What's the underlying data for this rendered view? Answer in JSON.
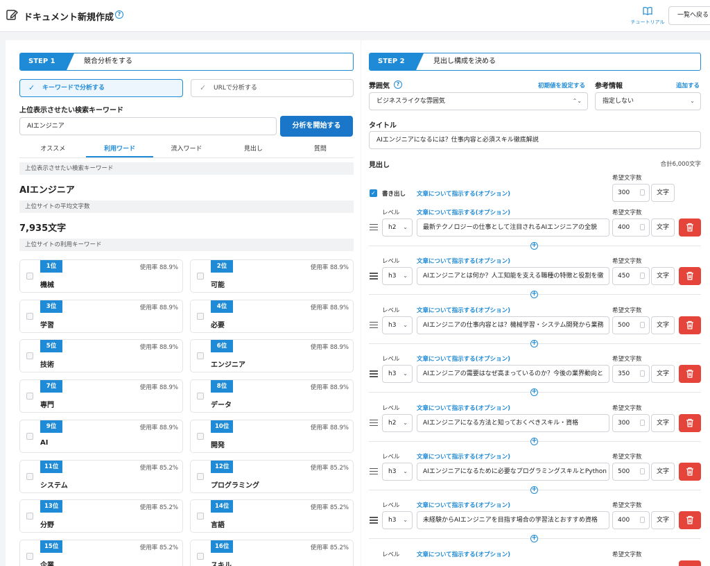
{
  "header": {
    "title": "ドキュメント新規作成",
    "tutorial_label": "チュートリアル",
    "back_label": "一覧へ戻る"
  },
  "left": {
    "step_badge": "STEP 1",
    "step_title": "競合分析をする",
    "mode_keyword": "キーワードで分析する",
    "mode_url": "URLで分析する",
    "keyword_label": "上位表示させたい検索キーワード",
    "keyword_value": "AIエンジニア",
    "start_button": "分析を開始する",
    "tabs": [
      "オススメ",
      "利用ワード",
      "流入ワード",
      "見出し",
      "質問"
    ],
    "active_tab": "利用ワード",
    "sec_keyword_band": "上位表示させたい検索キーワード",
    "keyword_display": "AIエンジニア",
    "sec_avg_band": "上位サイトの平均文字数",
    "avg_chars": "7,935文字",
    "sec_used_band": "上位サイトの利用キーワード",
    "keywords": [
      {
        "rank": "1位",
        "rate": "使用率 88.9%",
        "word": "機械"
      },
      {
        "rank": "2位",
        "rate": "使用率 88.9%",
        "word": "可能"
      },
      {
        "rank": "3位",
        "rate": "使用率 88.9%",
        "word": "学習"
      },
      {
        "rank": "4位",
        "rate": "使用率 88.9%",
        "word": "必要"
      },
      {
        "rank": "5位",
        "rate": "使用率 88.9%",
        "word": "技術"
      },
      {
        "rank": "6位",
        "rate": "使用率 88.9%",
        "word": "エンジニア"
      },
      {
        "rank": "7位",
        "rate": "使用率 88.9%",
        "word": "専門"
      },
      {
        "rank": "8位",
        "rate": "使用率 88.9%",
        "word": "データ"
      },
      {
        "rank": "9位",
        "rate": "使用率 88.9%",
        "word": "AI"
      },
      {
        "rank": "10位",
        "rate": "使用率 88.9%",
        "word": "開発"
      },
      {
        "rank": "11位",
        "rate": "使用率 85.2%",
        "word": "システム"
      },
      {
        "rank": "12位",
        "rate": "使用率 85.2%",
        "word": "プログラミング"
      },
      {
        "rank": "13位",
        "rate": "使用率 85.2%",
        "word": "分野"
      },
      {
        "rank": "14位",
        "rate": "使用率 85.2%",
        "word": "言語"
      },
      {
        "rank": "15位",
        "rate": "使用率 85.2%",
        "word": "企業"
      },
      {
        "rank": "16位",
        "rate": "使用率 85.2%",
        "word": "スキル"
      }
    ]
  },
  "right": {
    "step_badge": "STEP 2",
    "step_title": "見出し構成を決める",
    "mood_label": "雰囲気",
    "mood_reset_link": "初期値を設定する",
    "mood_value": "ビジネスライクな雰囲気",
    "ref_label": "参考情報",
    "ref_add_link": "追加する",
    "ref_value": "指定しない",
    "title_label": "タイトル",
    "title_value": "AIエンジニアになるには？仕事内容と必須スキル徹底解説",
    "headings_label": "見出し",
    "total_chars": "合計6,000文字",
    "intro": {
      "checkbox_label": "書き出し",
      "option_link": "文章について指示する(オプション)",
      "chars_label": "希望文字数",
      "chars": "300",
      "unit": "文字"
    },
    "level_label": "レベル",
    "option_link": "文章について指示する(オプション)",
    "chars_label": "希望文字数",
    "unit": "文字",
    "headings": [
      {
        "level": "h2",
        "text": "最新テクノロジーの仕事として注目されるAIエンジニアの全貌",
        "chars": "400"
      },
      {
        "level": "h3",
        "text": "AIエンジニアとは何か？人工知能を支える職種の特徴と役割を徹",
        "chars": "450"
      },
      {
        "level": "h3",
        "text": "AIエンジニアの仕事内容とは？機械学習・システム開発から業務",
        "chars": "500"
      },
      {
        "level": "h3",
        "text": "AIエンジニアの需要はなぜ高まっているのか？今後の業界動向と",
        "chars": "350"
      },
      {
        "level": "h2",
        "text": "AIエンジニアになる方法と知っておくべきスキル・資格",
        "chars": "300"
      },
      {
        "level": "h3",
        "text": "AIエンジニアになるために必要なプログラミングスキルとPython",
        "chars": "500"
      },
      {
        "level": "h3",
        "text": "未経験からAIエンジニアを目指す場合の学習法とおすすめ資格",
        "chars": "400"
      }
    ]
  },
  "icons": {
    "edit": "edit-icon",
    "help": "help-circle-icon",
    "book": "book-icon",
    "check": "check-icon",
    "drag": "drag-handle-icon",
    "trash": "trash-icon",
    "add": "plus-circle-icon",
    "lock": "lock-icon"
  },
  "colors": {
    "accent": "#1f8ad6",
    "primary_button": "#1976c8",
    "delete": "#e5443b"
  }
}
